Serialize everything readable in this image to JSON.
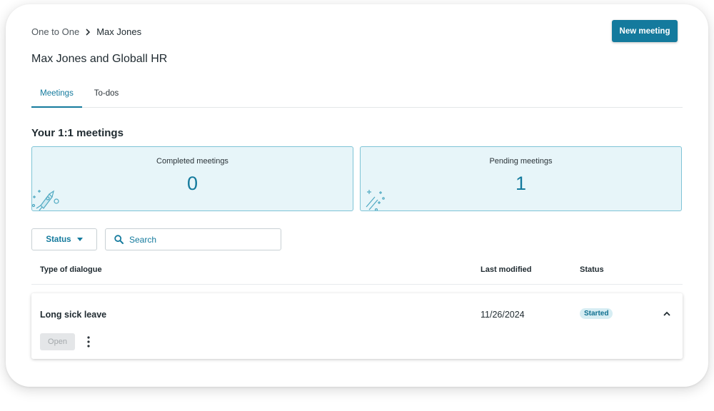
{
  "breadcrumb": {
    "parent": "One to One",
    "current": "Max Jones"
  },
  "header": {
    "new_meeting_label": "New meeting",
    "title": "Max Jones and Globall HR"
  },
  "tabs": [
    {
      "label": "Meetings",
      "active": true
    },
    {
      "label": "To-dos",
      "active": false
    }
  ],
  "section": {
    "title": "Your 1:1 meetings"
  },
  "stats": {
    "completed": {
      "label": "Completed meetings",
      "value": "0",
      "icon": "rocket-illustration"
    },
    "pending": {
      "label": "Pending meetings",
      "value": "1",
      "icon": "sparkle-illustration"
    }
  },
  "filters": {
    "status_label": "Status",
    "search_placeholder": "Search"
  },
  "table": {
    "columns": {
      "type": "Type of dialogue",
      "modified": "Last modified",
      "status": "Status"
    },
    "rows": [
      {
        "type": "Long sick leave",
        "modified": "11/26/2024",
        "status": "Started",
        "open_label": "Open"
      }
    ]
  },
  "colors": {
    "accent": "#147a9d",
    "card_bg": "#e7f5f9",
    "card_border": "#7fc4d6",
    "badge_bg": "#d6edf3"
  }
}
